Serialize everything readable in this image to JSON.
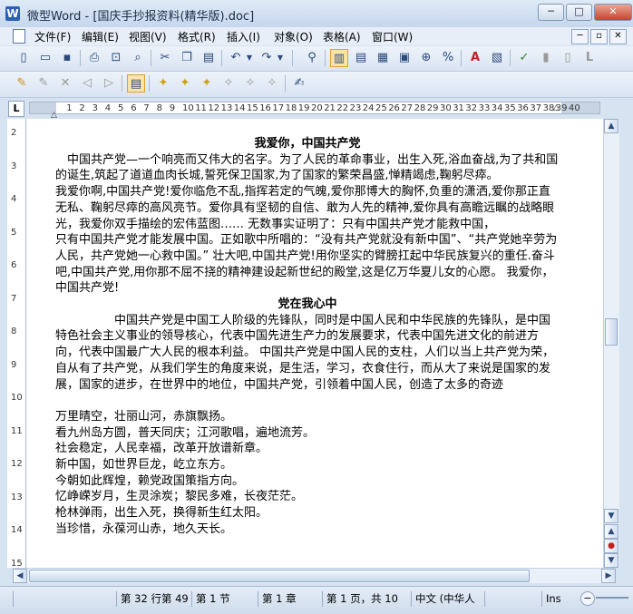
{
  "window": {
    "title": "微型Word - [国庆手抄报资料(精华版).doc]",
    "app_icon_letter": "W",
    "minimize": "─",
    "maximize": "□",
    "close": "✕"
  },
  "menu": {
    "items": [
      "文件(F)",
      "编辑(E)",
      "视图(V)",
      "格式(R)",
      "插入(I)",
      "对象(O)",
      "表格(A)",
      "窗口(W)"
    ],
    "mdi_minimize": "─",
    "mdi_restore": "▫",
    "mdi_close": "✕"
  },
  "ruler": {
    "corner": "L",
    "numbers": [
      "1",
      "2",
      "3",
      "4",
      "5",
      "6",
      "7",
      "8",
      "9",
      "10",
      "11",
      "12",
      "13",
      "14",
      "15",
      "16",
      "17",
      "18",
      "19",
      "20",
      "21",
      "22",
      "23",
      "24",
      "25",
      "26",
      "27",
      "28",
      "29",
      "30",
      "31",
      "32",
      "33",
      "34",
      "35",
      "36",
      "37",
      "38",
      "39",
      "40"
    ]
  },
  "vruler": {
    "numbers": [
      "2",
      "3",
      "4",
      "5",
      "6",
      "7",
      "8",
      "9",
      "10",
      "11",
      "12",
      "13",
      "14",
      "15"
    ]
  },
  "document": {
    "paragraphs": [
      {
        "type": "heading",
        "text": "我爱你，中国共产党"
      },
      {
        "type": "body",
        "text": "　中国共产党—一个响亮而又伟大的名字。为了人民的革命事业，出生入死,浴血奋战,为了共和国的诞生,筑起了道道血肉长城,誓死保卫国家,为了国家的繁荣昌盛,惮精竭虑,鞠躬尽瘁。"
      },
      {
        "type": "body",
        "text": "我爱你啊,中国共产党!爱你临危不乱,指挥若定的气魄,爱你那博大的胸怀,负重的潇洒,爱你那正直无私、鞠躬尽瘁的高风亮节。爱你具有坚韧的自信、敢为人先的精神,爱你具有高瞻远瞩的战略眼光，我爱你双手描绘的宏伟蓝图…… 无数事实证明了：只有中国共产党才能救中国，"
      },
      {
        "type": "body",
        "text": "只有中国共产党才能发展中国。正如歌中所唱的：“没有共产党就没有新中国”、“共产党她辛劳为人民，共产党她一心救中国。” 壮大吧,中国共产党!用你坚实的臂膀扛起中华民族复兴的重任.奋斗吧,中国共产党,用你那不屈不挠的精神建设起新世纪的殿堂,这是亿万华夏儿女的心愿。 我爱你，中国共产党!"
      },
      {
        "type": "heading",
        "text": "党在我心中"
      },
      {
        "type": "body",
        "text": "　　　　　中国共产党是中国工人阶级的先锋队，同时是中国人民和中华民族的先锋队，是中国特色社会主义事业的领导核心，代表中国先进生产力的发展要求，代表中国先进文化的前进方向，代表中国最广大人民的根本利益。 中国共产党是中国人民的支柱，人们以当上共产党为荣，自从有了共产党，从我们学生的角度来说，是生活，学习，衣食住行，而从大了来说是国家的发展，国家的进步，在世界中的地位，中国共产党，引领着中国人民，创造了太多的奇迹"
      },
      {
        "type": "blank",
        "text": ""
      },
      {
        "type": "body",
        "text": "万里晴空，壮丽山河，赤旗飘扬。"
      },
      {
        "type": "body",
        "text": "看九州岛方圆，普天同庆；江河歌唱，遍地流芳。"
      },
      {
        "type": "body",
        "text": "社会稳定，人民幸福，改革开放谱新章。"
      },
      {
        "type": "body",
        "text": "新中国，如世界巨龙，屹立东方。"
      },
      {
        "type": "body",
        "text": "今朝如此辉煌，赖党政国策指方向。"
      },
      {
        "type": "body",
        "text": "忆峥嵘岁月，生灵涂炭；黎民多难，长夜茫茫。"
      },
      {
        "type": "body",
        "text": "枪林弹雨，出生入死，换得新生红太阳。"
      },
      {
        "type": "body",
        "text": "当珍惜，永葆河山赤，地久天长。"
      }
    ]
  },
  "scrollbars": {
    "up": "▲",
    "down": "▼",
    "left": "◀",
    "right": "▶",
    "prev_page": "▲",
    "select_browse": "●",
    "next_page": "▼"
  },
  "status": {
    "position": "第 32 行第 49",
    "section": "第 1 节",
    "chapter": "第 1 章",
    "page": "第 1 页，共 10",
    "language": "中文 (中华人",
    "mode": "Ins",
    "zoom_minus": "−"
  }
}
